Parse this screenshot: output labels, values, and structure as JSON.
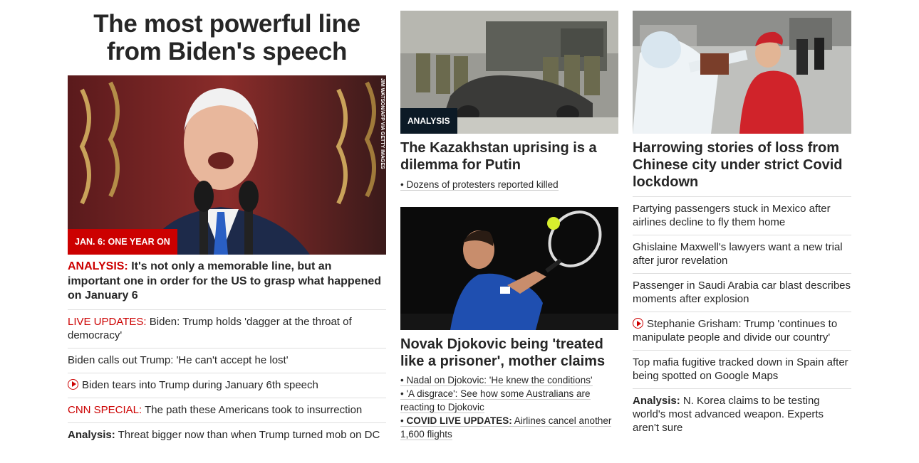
{
  "col1": {
    "headline": "The most powerful line from Biden's speech",
    "image_label": "JAN. 6: ONE YEAR ON",
    "image_credit": "JIM WATSON/AFP VIA GETTY IMAGES",
    "lead_prefix": "ANALYSIS:",
    "lead_text": " It's not only a memorable line, but an important one in order for the US to grasp what happened on January 6",
    "links": [
      {
        "prefix": "LIVE UPDATES:",
        "text": " Biden: Trump holds 'dagger at the throat of democracy'"
      },
      {
        "text": "Biden calls out Trump: 'He can't accept he lost'"
      },
      {
        "text": "Biden tears into Trump during January 6th speech"
      },
      {
        "prefix": "CNN SPECIAL:",
        "text": " The path these Americans took to insurrection"
      },
      {
        "prefix": "Analysis:",
        "text": " Threat bigger now than when Trump turned mob on DC"
      }
    ]
  },
  "col2": {
    "card1": {
      "label": "ANALYSIS",
      "headline": "The Kazakhstan uprising is a dilemma for Putin",
      "subs": [
        "Dozens of protesters reported killed"
      ]
    },
    "card2": {
      "headline": "Novak Djokovic being 'treated like a prisoner', mother claims",
      "subs": [
        {
          "text": "Nadal on Djokovic: 'He knew the conditions'"
        },
        {
          "text": "'A disgrace': See how some Australians are reacting to Djokovic"
        },
        {
          "prefix": "COVID LIVE UPDATES:",
          "text": " Airlines cancel another 1,600 flights"
        }
      ]
    }
  },
  "col3": {
    "headline": "Harrowing stories of loss from Chinese city under strict Covid lockdown",
    "links": [
      {
        "text": "Partying passengers stuck in Mexico after airlines decline to fly them home"
      },
      {
        "text": "Ghislaine Maxwell's lawyers want a new trial after juror revelation"
      },
      {
        "text": "Passenger in Saudi Arabia car blast describes moments after explosion"
      },
      {
        "text": "Stephanie Grisham: Trump 'continues to manipulate people and divide our country'"
      },
      {
        "text": "Top mafia fugitive tracked down in Spain after being spotted on Google Maps"
      },
      {
        "prefix": "Analysis:",
        "text": " N. Korea claims to be testing world's most advanced weapon. Experts aren't sure"
      }
    ]
  },
  "colors": {
    "accent_red": "#cc0000",
    "label_dark": "#0c1a26",
    "text": "#262626",
    "divider": "#dedede"
  },
  "icons": {
    "video": "play-circle-icon"
  }
}
